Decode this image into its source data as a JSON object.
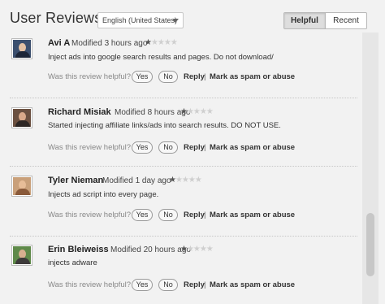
{
  "header": {
    "title": "User Reviews",
    "language": "English (United States)",
    "sort_helpful": "Helpful",
    "sort_recent": "Recent"
  },
  "common": {
    "helpful_question": "Was this review helpful?",
    "yes": "Yes",
    "no": "No",
    "reply": "Reply",
    "separator": "|",
    "spam": "Mark as spam or abuse"
  },
  "reviews": [
    {
      "author": "Avi A",
      "modified": "Modified 3 hours ago",
      "rating": 1,
      "max_rating": 5,
      "text": "Inject ads into google search results and pages. Do not download/"
    },
    {
      "author": "Richard Misiak",
      "modified": "Modified 8 hours ago",
      "rating": 1,
      "max_rating": 5,
      "text": "Started injecting affiliate links/ads into search results. DO NOT USE."
    },
    {
      "author": "Tyler Nieman",
      "modified": "Modified 1 day ago",
      "rating": 1,
      "max_rating": 5,
      "text": "Injects ad script into every page."
    },
    {
      "author": "Erin Bleiweiss",
      "modified": "Modified 20 hours ago",
      "rating": 1,
      "max_rating": 5,
      "text": "injects adware"
    }
  ],
  "colors": {
    "background": "#f2f2f2",
    "star_filled": "#555555",
    "star_empty": "#cfcfcf"
  }
}
